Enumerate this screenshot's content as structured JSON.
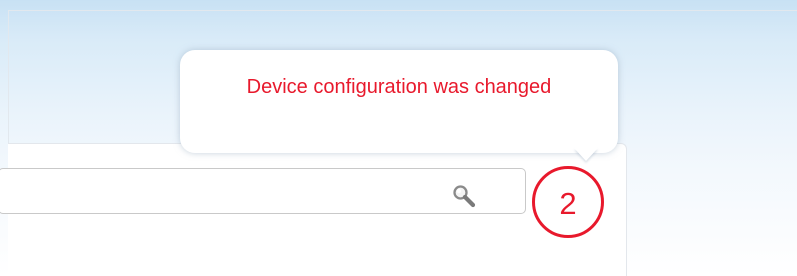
{
  "notification": {
    "message": "Device configuration was changed",
    "count": "2",
    "color": "#e8192c"
  },
  "search": {
    "placeholder": "",
    "value": "",
    "icon": "search-icon"
  }
}
